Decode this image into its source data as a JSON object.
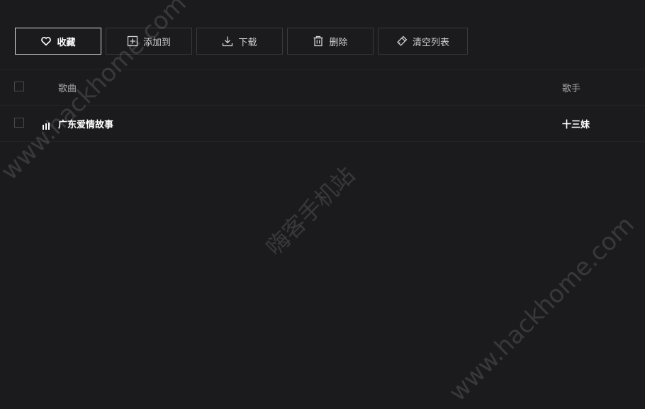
{
  "toolbar": {
    "favorite_label": "收藏",
    "add_to_label": "添加到",
    "download_label": "下载",
    "delete_label": "删除",
    "clear_list_label": "清空列表"
  },
  "table": {
    "headers": {
      "song": "歌曲",
      "singer": "歌手"
    },
    "rows": [
      {
        "song": "广东爱情故事",
        "singer": "十三妹",
        "status_icon": "now-playing-icon"
      }
    ]
  },
  "watermarks": {
    "text_1": "www.hackhome.com",
    "text_2": "嗨客手机站",
    "text_3": "www.hackhome.com"
  },
  "icons": {
    "favorite": "heart-icon",
    "add_to": "plus-square-icon",
    "download": "download-icon",
    "delete": "trash-icon",
    "clear_list": "broom-icon"
  },
  "colors": {
    "background": "#1b1b1d",
    "primary_border": "#d9d9d9",
    "border": "#3a3a3c",
    "text": "#e6e6e6"
  }
}
